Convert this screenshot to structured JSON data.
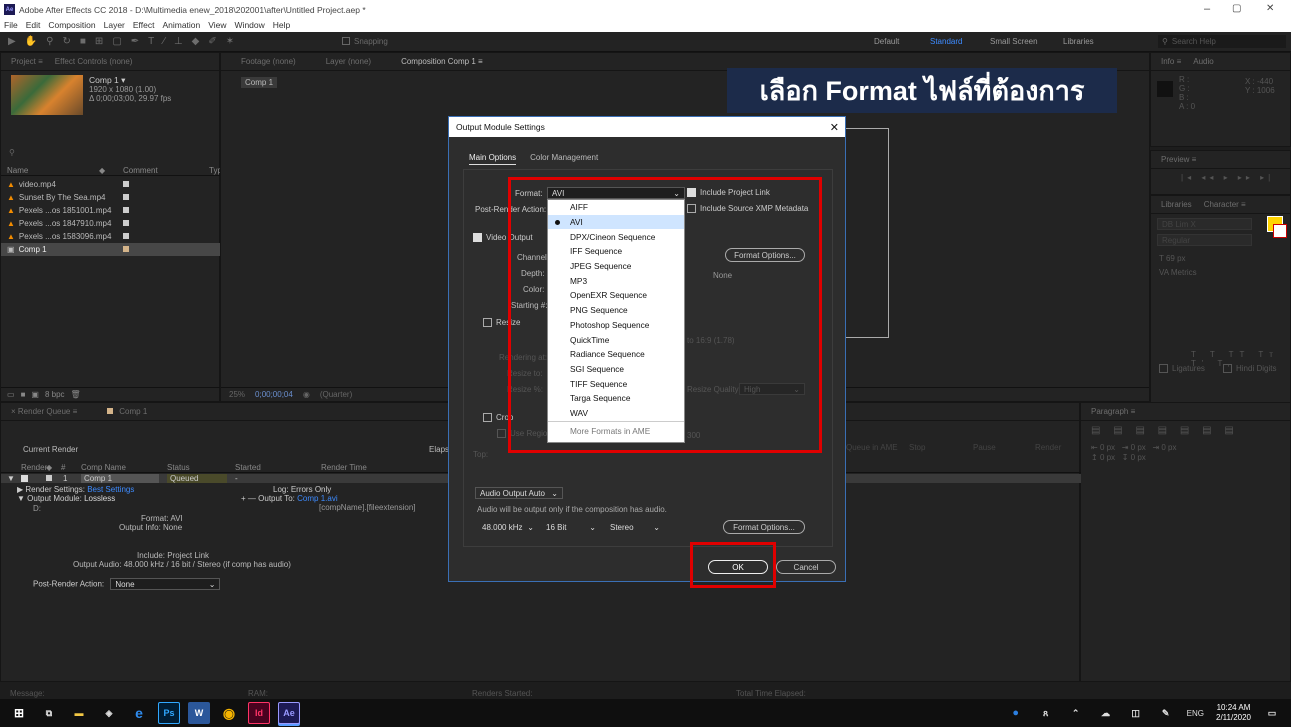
{
  "window": {
    "title": "Adobe After Effects CC 2018 - D:\\Multimedia enew_2018\\202001\\after\\Untitled Project.aep *",
    "controls": [
      "–",
      "▢",
      "✕"
    ]
  },
  "menu": [
    "File",
    "Edit",
    "Composition",
    "Layer",
    "Effect",
    "Animation",
    "View",
    "Window",
    "Help"
  ],
  "toolbar": {
    "snapping": "Snapping",
    "workspaces": [
      "Default",
      "Standard",
      "Small Screen",
      "Libraries"
    ],
    "search_placeholder": "Search Help"
  },
  "project": {
    "tabs": [
      "Project ≡",
      "Effect Controls (none)"
    ],
    "comp_name": "Comp 1 ▾",
    "comp_res": "1920 x 1080 (1.00)",
    "comp_dur": "Δ 0;00;03;00, 29.97 fps",
    "columns": [
      "Name",
      "Comment",
      "Typ"
    ],
    "items": [
      "video.mp4",
      "Sunset By The Sea.mp4",
      "Pexels ...os 1851001.mp4",
      "Pexels ...os 1847910.mp4",
      "Pexels ...os 1583096.mp4",
      "Comp 1"
    ],
    "bpc": "8 bpc"
  },
  "viewer": {
    "tabs": [
      "Footage (none)",
      "Layer (none)",
      "Composition Comp 1 ≡"
    ],
    "comp_tab": "Comp 1",
    "zoom": "25%",
    "time": "0;00;00;04",
    "quality": "(Quarter)"
  },
  "annotation": "เลือก Format ไฟล์ที่ต้องการ",
  "right_panels": {
    "info_tabs": [
      "Info ≡",
      "Audio"
    ],
    "info_vals": [
      "R :",
      "G :",
      "B :",
      "A : 0"
    ],
    "coords": [
      "X : -440",
      "Y : 1006"
    ],
    "preview": "Preview ≡",
    "lib_tabs": [
      "Libraries",
      "Character ≡"
    ],
    "font": "DB Lim X",
    "style": "Regular",
    "size": "69 px",
    "metrics": "Metrics",
    "ligatures": "Ligatures",
    "hindi": "Hindi Digits",
    "paragraph": "Paragraph ≡",
    "para_vals": [
      "0 px",
      "0 px",
      "0 px",
      "0 px",
      "0 px"
    ]
  },
  "render_queue": {
    "tabs": [
      "× Render Queue ≡",
      "Comp 1"
    ],
    "current_render": "Current Render",
    "elapsed": "Elapsed:",
    "buttons": [
      "Queue in AME",
      "Stop",
      "Pause",
      "Render"
    ],
    "columns": [
      "Render",
      "#",
      "Comp Name",
      "Status",
      "Started",
      "Render Time"
    ],
    "item_num": "1",
    "item_comp": "Comp 1",
    "item_status": "Queued",
    "item_started": "-",
    "render_settings_label": "Render Settings:",
    "render_settings": "Best Settings",
    "log_label": "Log:",
    "log": "Errors Only",
    "output_module_label": "Output Module:",
    "output_module": "Lossless",
    "output_to_label": "Output To:",
    "output_to": "Comp 1.avi",
    "output_pattern": "[compName].[fileextension]",
    "d": "D:",
    "format_line": "Format: AVI",
    "output_info": "Output Info: None",
    "include_line": "Include: Project Link",
    "output_audio": "Output Audio: 48.000 kHz / 16 bit / Stereo (if comp has audio)",
    "post_render_label": "Post-Render Action:",
    "post_render": "None"
  },
  "status_bar": {
    "message": "Message:",
    "ram": "RAM:",
    "renders_started": "Renders Started:",
    "total_time": "Total Time Elapsed:"
  },
  "dialog": {
    "title": "Output Module Settings",
    "tabs": [
      "Main Options",
      "Color Management"
    ],
    "format_label": "Format:",
    "format_value": "AVI",
    "include_project_link": "Include Project Link",
    "post_render_label": "Post-Render Action:",
    "include_xmp": "Include Source XMP Metadata",
    "video_output": "Video Output",
    "channels": "Channels:",
    "depth": "Depth:",
    "color": "Color:",
    "starting": "Starting #:",
    "format_options": "Format Options...",
    "none": "None",
    "resize": "Resize",
    "rendering_at": "Rendering at:",
    "resize_to": "Resize to:",
    "resize_pct": "Resize %:",
    "aspect": "to 16:9 (1.78)",
    "resize_quality": "Resize Quality:",
    "resize_quality_val": "High",
    "crop": "Crop",
    "use_region": "Use Region of Interest",
    "top": "Top:",
    "final_size": "300",
    "audio_output": "Audio Output Auto",
    "audio_note": "Audio will be output only if the composition has audio.",
    "sample_rate": "48.000 kHz",
    "bit_depth": "16 Bit",
    "stereo": "Stereo",
    "audio_format_options": "Format Options...",
    "ok": "OK",
    "cancel": "Cancel"
  },
  "dropdown": {
    "items": [
      "AIFF",
      "AVI",
      "DPX/Cineon Sequence",
      "IFF Sequence",
      "JPEG Sequence",
      "MP3",
      "OpenEXR Sequence",
      "PNG Sequence",
      "Photoshop Sequence",
      "QuickTime",
      "Radiance Sequence",
      "SGI Sequence",
      "TIFF Sequence",
      "Targa Sequence",
      "WAV",
      "More Formats in AME"
    ],
    "selected_index": 1
  },
  "taskbar": {
    "time": "10:24 AM",
    "date": "2/11/2020",
    "lang": "ENG"
  },
  "colors": {
    "accent": "#3d8bff",
    "highlight": "#e00000",
    "annotation_bg": "#1c2b4a"
  }
}
